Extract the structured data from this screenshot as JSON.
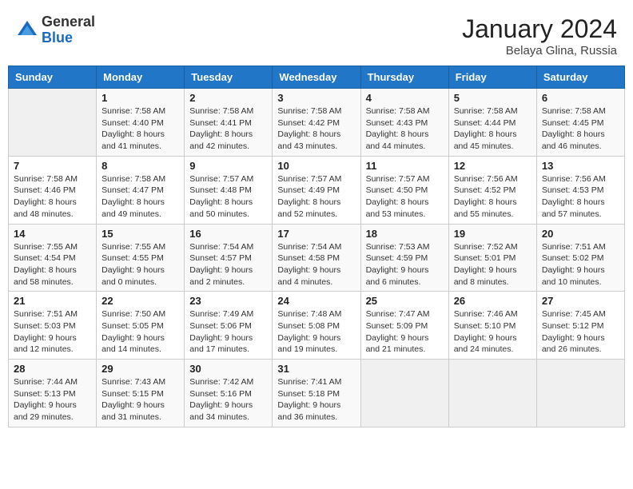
{
  "header": {
    "logo_general": "General",
    "logo_blue": "Blue",
    "month_title": "January 2024",
    "location": "Belaya Glina, Russia"
  },
  "weekdays": [
    "Sunday",
    "Monday",
    "Tuesday",
    "Wednesday",
    "Thursday",
    "Friday",
    "Saturday"
  ],
  "weeks": [
    [
      {
        "day": "",
        "sunrise": "",
        "sunset": "",
        "daylight": ""
      },
      {
        "day": "1",
        "sunrise": "Sunrise: 7:58 AM",
        "sunset": "Sunset: 4:40 PM",
        "daylight": "Daylight: 8 hours and 41 minutes."
      },
      {
        "day": "2",
        "sunrise": "Sunrise: 7:58 AM",
        "sunset": "Sunset: 4:41 PM",
        "daylight": "Daylight: 8 hours and 42 minutes."
      },
      {
        "day": "3",
        "sunrise": "Sunrise: 7:58 AM",
        "sunset": "Sunset: 4:42 PM",
        "daylight": "Daylight: 8 hours and 43 minutes."
      },
      {
        "day": "4",
        "sunrise": "Sunrise: 7:58 AM",
        "sunset": "Sunset: 4:43 PM",
        "daylight": "Daylight: 8 hours and 44 minutes."
      },
      {
        "day": "5",
        "sunrise": "Sunrise: 7:58 AM",
        "sunset": "Sunset: 4:44 PM",
        "daylight": "Daylight: 8 hours and 45 minutes."
      },
      {
        "day": "6",
        "sunrise": "Sunrise: 7:58 AM",
        "sunset": "Sunset: 4:45 PM",
        "daylight": "Daylight: 8 hours and 46 minutes."
      }
    ],
    [
      {
        "day": "7",
        "sunrise": "Sunrise: 7:58 AM",
        "sunset": "Sunset: 4:46 PM",
        "daylight": "Daylight: 8 hours and 48 minutes."
      },
      {
        "day": "8",
        "sunrise": "Sunrise: 7:58 AM",
        "sunset": "Sunset: 4:47 PM",
        "daylight": "Daylight: 8 hours and 49 minutes."
      },
      {
        "day": "9",
        "sunrise": "Sunrise: 7:57 AM",
        "sunset": "Sunset: 4:48 PM",
        "daylight": "Daylight: 8 hours and 50 minutes."
      },
      {
        "day": "10",
        "sunrise": "Sunrise: 7:57 AM",
        "sunset": "Sunset: 4:49 PM",
        "daylight": "Daylight: 8 hours and 52 minutes."
      },
      {
        "day": "11",
        "sunrise": "Sunrise: 7:57 AM",
        "sunset": "Sunset: 4:50 PM",
        "daylight": "Daylight: 8 hours and 53 minutes."
      },
      {
        "day": "12",
        "sunrise": "Sunrise: 7:56 AM",
        "sunset": "Sunset: 4:52 PM",
        "daylight": "Daylight: 8 hours and 55 minutes."
      },
      {
        "day": "13",
        "sunrise": "Sunrise: 7:56 AM",
        "sunset": "Sunset: 4:53 PM",
        "daylight": "Daylight: 8 hours and 57 minutes."
      }
    ],
    [
      {
        "day": "14",
        "sunrise": "Sunrise: 7:55 AM",
        "sunset": "Sunset: 4:54 PM",
        "daylight": "Daylight: 8 hours and 58 minutes."
      },
      {
        "day": "15",
        "sunrise": "Sunrise: 7:55 AM",
        "sunset": "Sunset: 4:55 PM",
        "daylight": "Daylight: 9 hours and 0 minutes."
      },
      {
        "day": "16",
        "sunrise": "Sunrise: 7:54 AM",
        "sunset": "Sunset: 4:57 PM",
        "daylight": "Daylight: 9 hours and 2 minutes."
      },
      {
        "day": "17",
        "sunrise": "Sunrise: 7:54 AM",
        "sunset": "Sunset: 4:58 PM",
        "daylight": "Daylight: 9 hours and 4 minutes."
      },
      {
        "day": "18",
        "sunrise": "Sunrise: 7:53 AM",
        "sunset": "Sunset: 4:59 PM",
        "daylight": "Daylight: 9 hours and 6 minutes."
      },
      {
        "day": "19",
        "sunrise": "Sunrise: 7:52 AM",
        "sunset": "Sunset: 5:01 PM",
        "daylight": "Daylight: 9 hours and 8 minutes."
      },
      {
        "day": "20",
        "sunrise": "Sunrise: 7:51 AM",
        "sunset": "Sunset: 5:02 PM",
        "daylight": "Daylight: 9 hours and 10 minutes."
      }
    ],
    [
      {
        "day": "21",
        "sunrise": "Sunrise: 7:51 AM",
        "sunset": "Sunset: 5:03 PM",
        "daylight": "Daylight: 9 hours and 12 minutes."
      },
      {
        "day": "22",
        "sunrise": "Sunrise: 7:50 AM",
        "sunset": "Sunset: 5:05 PM",
        "daylight": "Daylight: 9 hours and 14 minutes."
      },
      {
        "day": "23",
        "sunrise": "Sunrise: 7:49 AM",
        "sunset": "Sunset: 5:06 PM",
        "daylight": "Daylight: 9 hours and 17 minutes."
      },
      {
        "day": "24",
        "sunrise": "Sunrise: 7:48 AM",
        "sunset": "Sunset: 5:08 PM",
        "daylight": "Daylight: 9 hours and 19 minutes."
      },
      {
        "day": "25",
        "sunrise": "Sunrise: 7:47 AM",
        "sunset": "Sunset: 5:09 PM",
        "daylight": "Daylight: 9 hours and 21 minutes."
      },
      {
        "day": "26",
        "sunrise": "Sunrise: 7:46 AM",
        "sunset": "Sunset: 5:10 PM",
        "daylight": "Daylight: 9 hours and 24 minutes."
      },
      {
        "day": "27",
        "sunrise": "Sunrise: 7:45 AM",
        "sunset": "Sunset: 5:12 PM",
        "daylight": "Daylight: 9 hours and 26 minutes."
      }
    ],
    [
      {
        "day": "28",
        "sunrise": "Sunrise: 7:44 AM",
        "sunset": "Sunset: 5:13 PM",
        "daylight": "Daylight: 9 hours and 29 minutes."
      },
      {
        "day": "29",
        "sunrise": "Sunrise: 7:43 AM",
        "sunset": "Sunset: 5:15 PM",
        "daylight": "Daylight: 9 hours and 31 minutes."
      },
      {
        "day": "30",
        "sunrise": "Sunrise: 7:42 AM",
        "sunset": "Sunset: 5:16 PM",
        "daylight": "Daylight: 9 hours and 34 minutes."
      },
      {
        "day": "31",
        "sunrise": "Sunrise: 7:41 AM",
        "sunset": "Sunset: 5:18 PM",
        "daylight": "Daylight: 9 hours and 36 minutes."
      },
      {
        "day": "",
        "sunrise": "",
        "sunset": "",
        "daylight": ""
      },
      {
        "day": "",
        "sunrise": "",
        "sunset": "",
        "daylight": ""
      },
      {
        "day": "",
        "sunrise": "",
        "sunset": "",
        "daylight": ""
      }
    ]
  ]
}
